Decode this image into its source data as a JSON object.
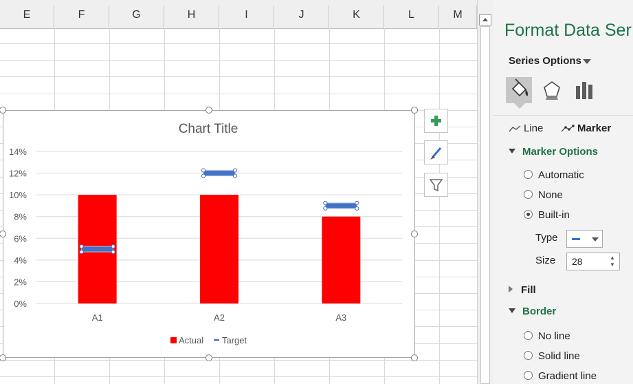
{
  "sheet": {
    "columns": [
      "E",
      "F",
      "G",
      "H",
      "I",
      "J",
      "K",
      "L",
      "M"
    ]
  },
  "chart": {
    "buttons": [
      {
        "name": "chart-elements-button",
        "icon": "plus-icon"
      },
      {
        "name": "chart-styles-button",
        "icon": "brush-icon"
      },
      {
        "name": "chart-filters-button",
        "icon": "filter-icon"
      }
    ]
  },
  "chart_data": {
    "type": "bar",
    "title": "Chart Title",
    "categories": [
      "A1",
      "A2",
      "A3"
    ],
    "series": [
      {
        "name": "Actual",
        "type": "bar",
        "color": "#ff0000",
        "values": [
          0.1,
          0.1,
          0.08
        ]
      },
      {
        "name": "Target",
        "type": "marker",
        "marker": "dash",
        "color": "#4472c4",
        "values": [
          0.05,
          0.12,
          0.09
        ]
      }
    ],
    "yticks": [
      "0%",
      "2%",
      "4%",
      "6%",
      "8%",
      "10%",
      "12%",
      "14%"
    ],
    "ylim": [
      0,
      0.14
    ],
    "grid": true,
    "legend": "bottom"
  },
  "pane": {
    "title": "Format Data Ser",
    "series_options_label": "Series Options",
    "tabs": [
      {
        "name": "fill-line-tab",
        "icon": "paint-bucket-icon",
        "active": true
      },
      {
        "name": "effects-tab",
        "icon": "pentagon-icon",
        "active": false
      },
      {
        "name": "series-options-tab",
        "icon": "bar-chart-icon",
        "active": false
      }
    ],
    "subtabs": {
      "line": "Line",
      "marker": "Marker"
    },
    "marker_options": {
      "title": "Marker Options",
      "radios": [
        "Automatic",
        "None",
        "Built-in"
      ],
      "selected": "Built-in",
      "type_label": "Type",
      "size_label": "Size",
      "size_value": "28"
    },
    "fill_label": "Fill",
    "border": {
      "title": "Border",
      "radios": [
        "No line",
        "Solid line",
        "Gradient line"
      ]
    },
    "accent_color": "#217346"
  }
}
